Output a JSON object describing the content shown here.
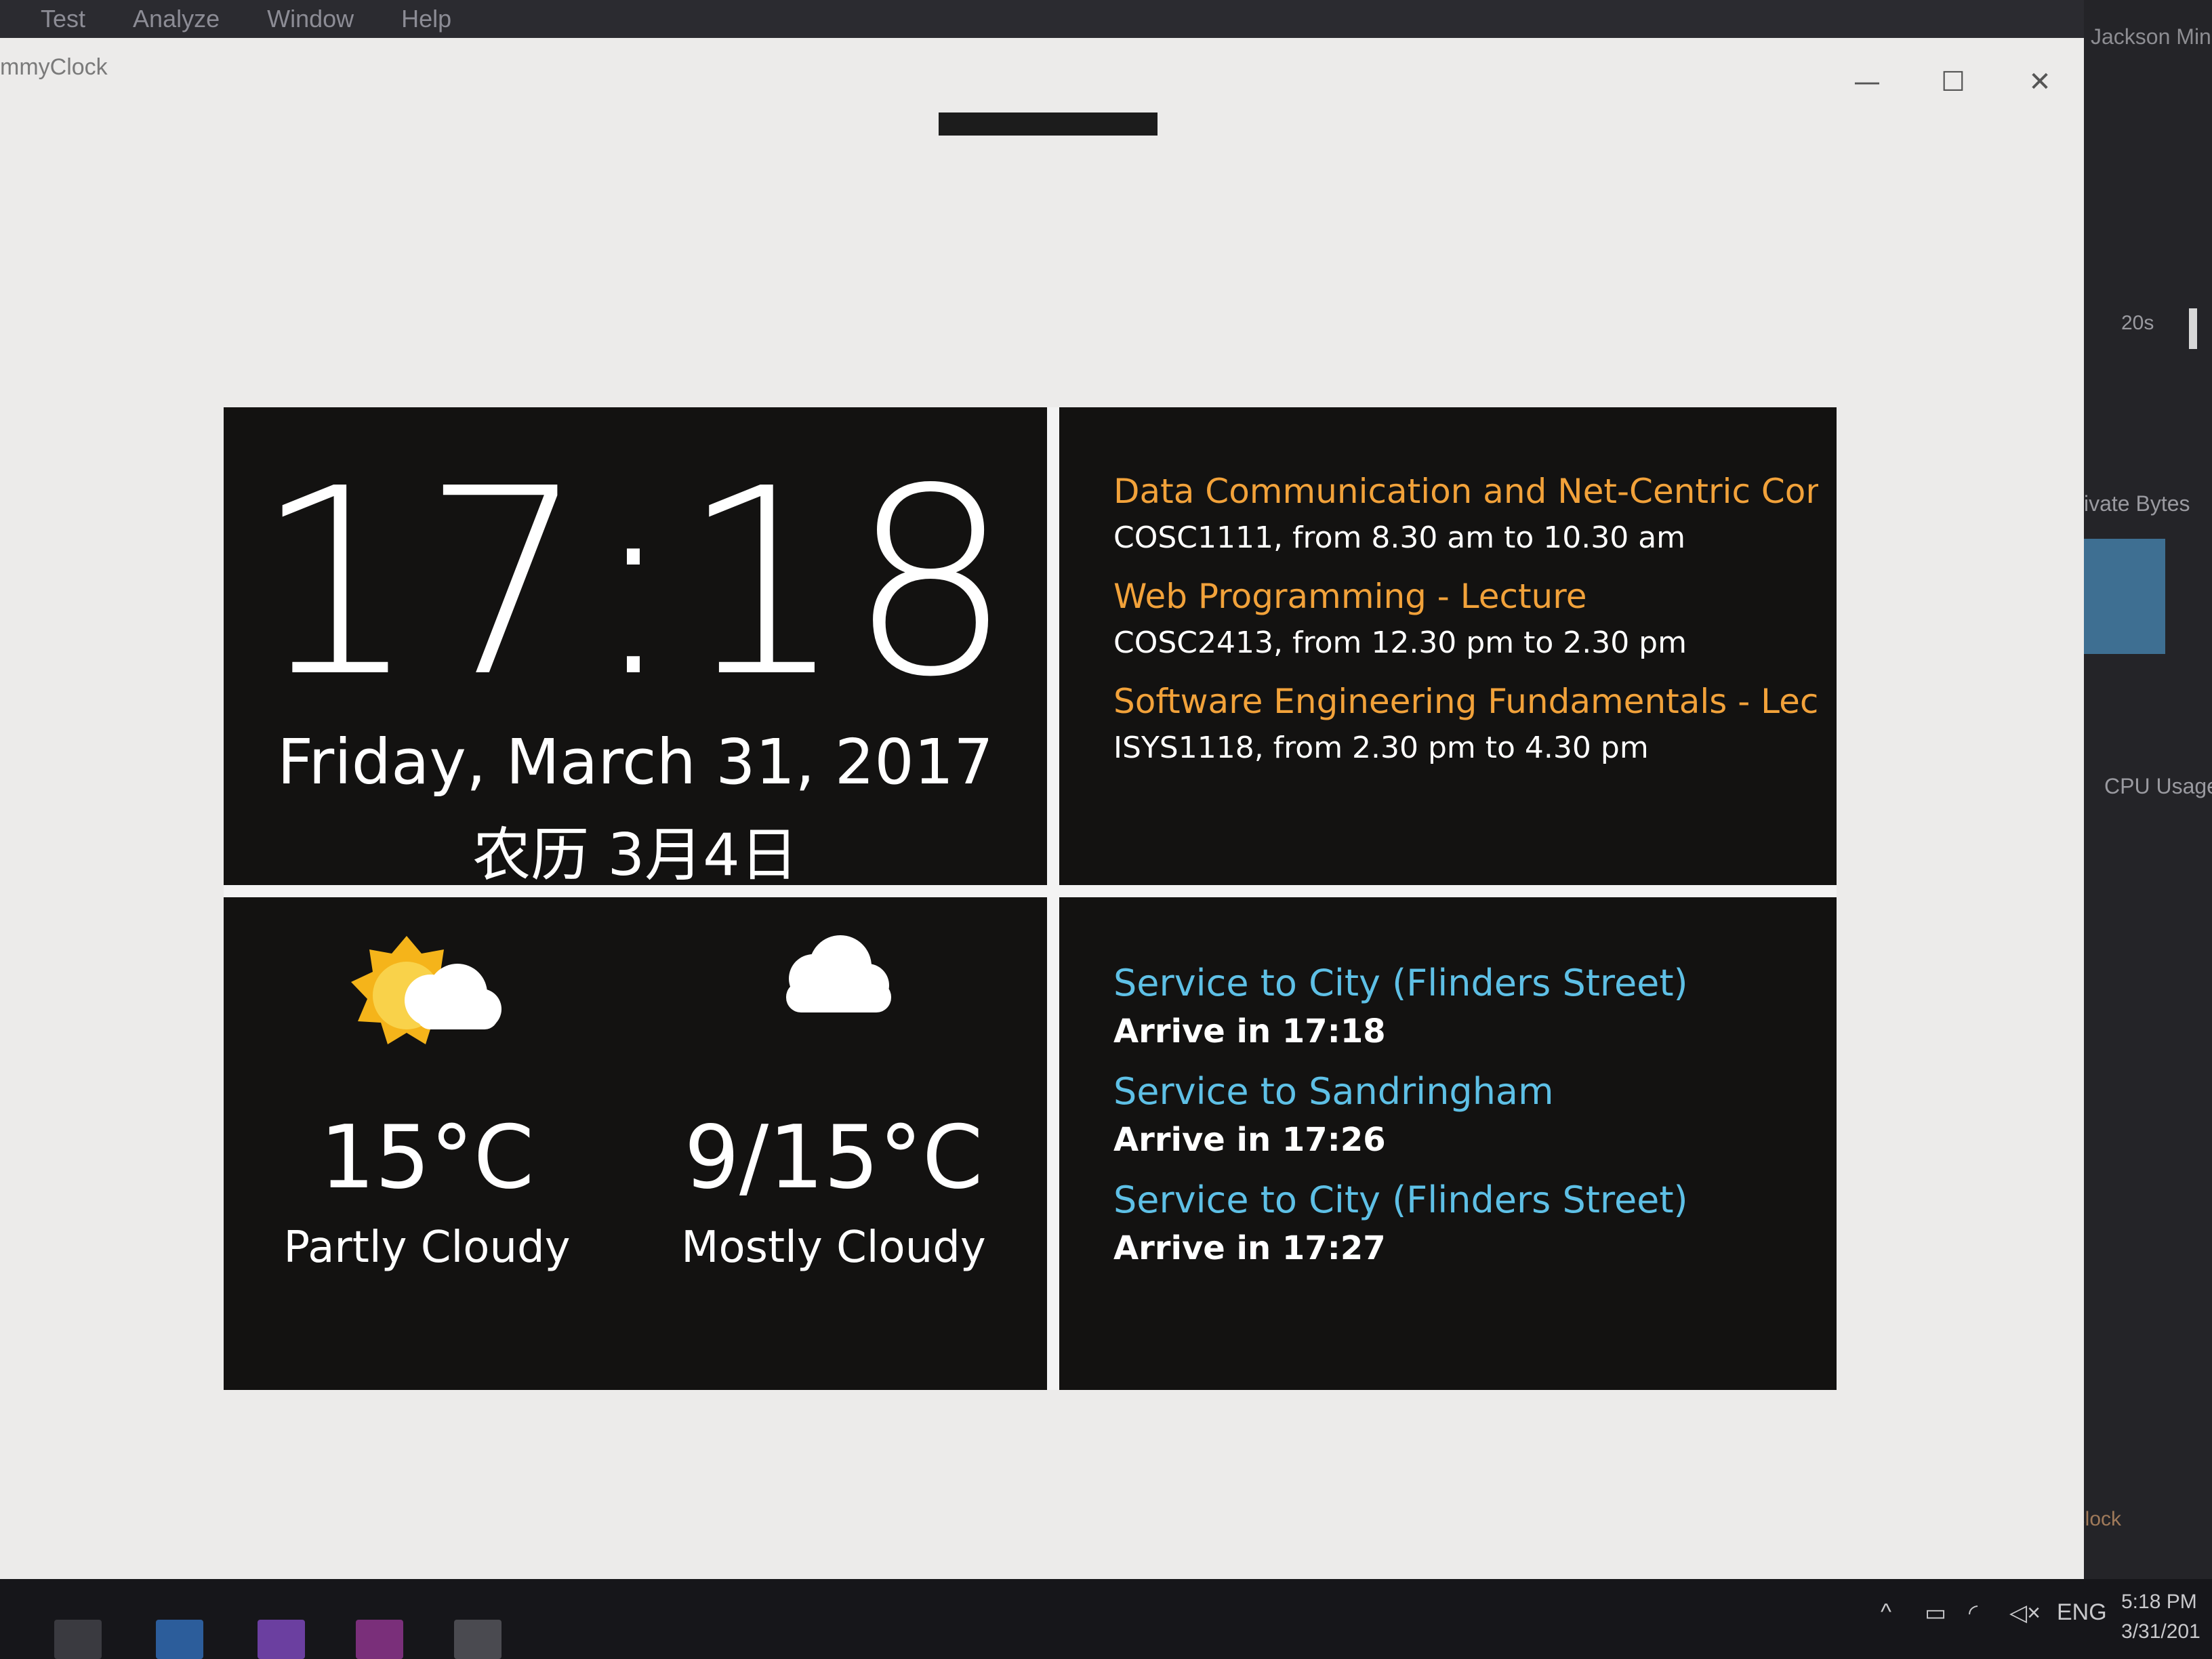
{
  "ide": {
    "menu": [
      "Test",
      "Analyze",
      "Window",
      "Help"
    ],
    "user": "Jackson Min",
    "timer": "20s",
    "private_bytes_label": "ivate Bytes",
    "cpu_label": "CPU Usage",
    "clock_tab": "Clock"
  },
  "window": {
    "title": "mmyClock",
    "minimize_icon": "—",
    "maximize_icon": "☐",
    "close_icon": "✕"
  },
  "clock": {
    "time": "17:18",
    "date": "Friday, March 31, 2017",
    "lunar": "农历 3月4日"
  },
  "schedule": [
    {
      "title": "Data Communication and Net-Centric Comput",
      "detail": "COSC1111, from 8.30 am to 10.30 am"
    },
    {
      "title": "Web Programming - Lecture",
      "detail": "COSC2413, from 12.30 pm to 2.30 pm"
    },
    {
      "title": "Software Engineering Fundamentals - Lecture",
      "detail": "ISYS1118, from 2.30 pm to 4.30 pm"
    }
  ],
  "weather": {
    "today": {
      "icon": "partly-cloudy-icon",
      "temp": "15°C",
      "condition": "Partly Cloudy"
    },
    "forecast": {
      "icon": "cloud-icon",
      "temp": "9/15°C",
      "condition": "Mostly Cloudy"
    }
  },
  "transit": [
    {
      "service": "Service to City (Flinders Street)",
      "arrive": "Arrive in 17:18"
    },
    {
      "service": "Service to Sandringham",
      "arrive": "Arrive in 17:26"
    },
    {
      "service": "Service to City (Flinders Street)",
      "arrive": "Arrive in 17:27"
    }
  ],
  "taskbar": {
    "language": "ENG",
    "time": "5:18 PM",
    "date": "3/31/201"
  },
  "colors": {
    "schedule_title": "#f2a23a",
    "transit_service": "#5ec0e6",
    "panel_bg": "#131211",
    "sun": "#f5b41a",
    "cloud": "#ffffff"
  }
}
